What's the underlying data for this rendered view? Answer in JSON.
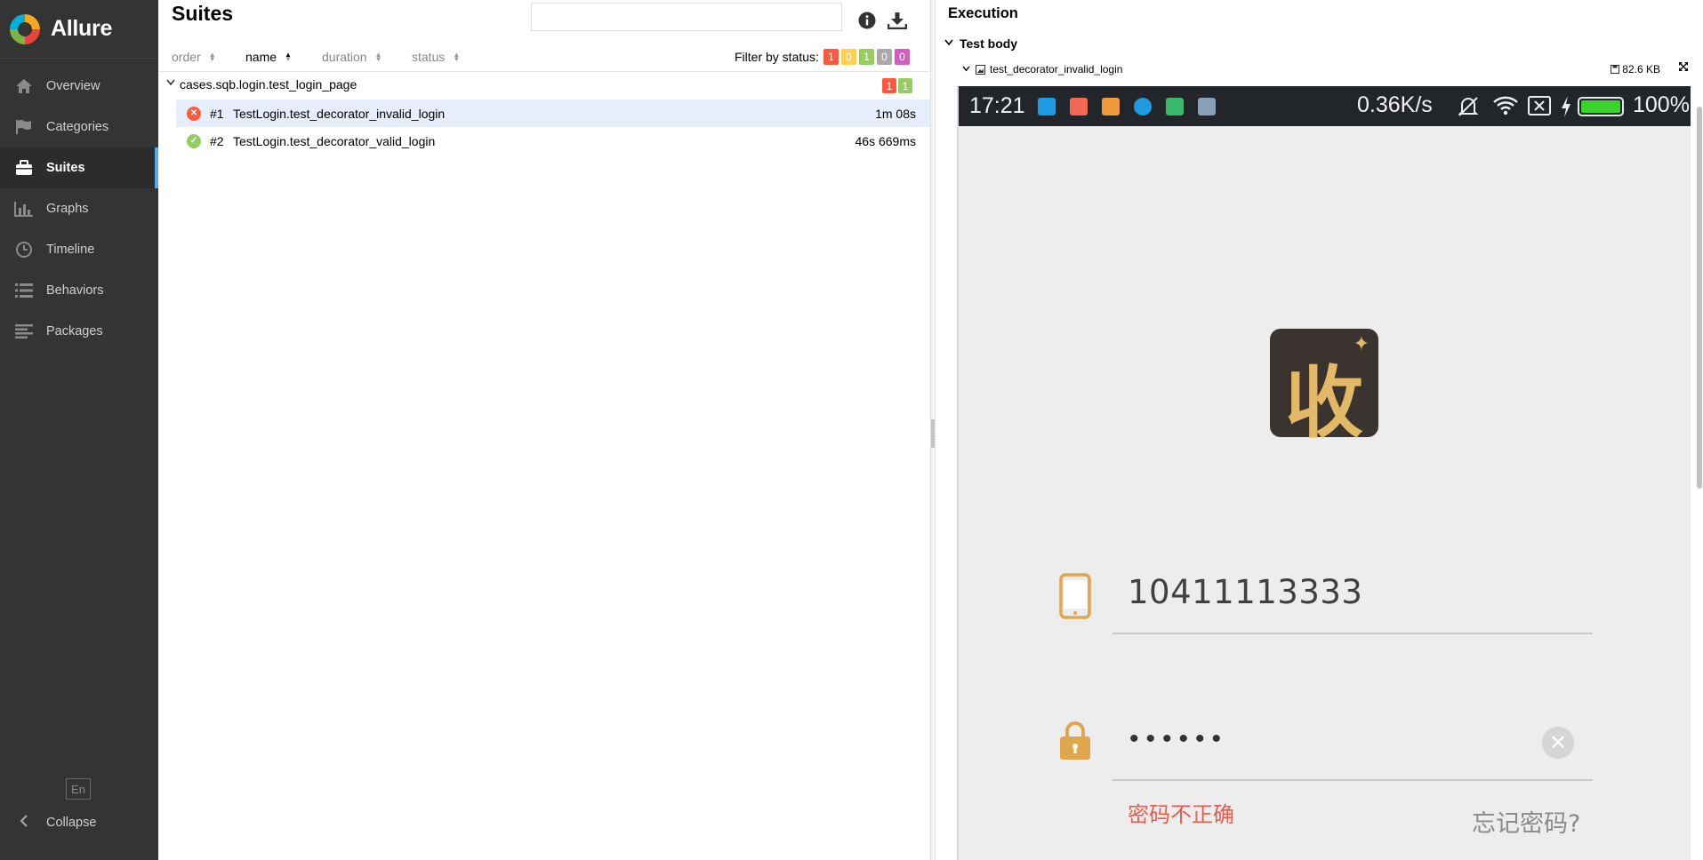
{
  "sidebar": {
    "brand": "Allure",
    "items": [
      {
        "label": "Overview",
        "icon": "home-icon"
      },
      {
        "label": "Categories",
        "icon": "flag-icon"
      },
      {
        "label": "Suites",
        "icon": "briefcase-icon",
        "active": true
      },
      {
        "label": "Graphs",
        "icon": "bar-chart-icon"
      },
      {
        "label": "Timeline",
        "icon": "clock-icon"
      },
      {
        "label": "Behaviors",
        "icon": "list-icon"
      },
      {
        "label": "Packages",
        "icon": "align-left-icon"
      }
    ],
    "language": "En",
    "collapse_label": "Collapse"
  },
  "suites": {
    "title": "Suites",
    "search": {
      "value": "",
      "placeholder": ""
    },
    "sort": {
      "order": "order",
      "name": "name",
      "duration": "duration",
      "status": "status"
    },
    "filter_label": "Filter by status:",
    "filter_counts": [
      {
        "value": "1",
        "status": "failed",
        "color": "#fd5a3e"
      },
      {
        "value": "0",
        "status": "broken",
        "color": "#ffd050"
      },
      {
        "value": "1",
        "status": "passed",
        "color": "#97cc64"
      },
      {
        "value": "0",
        "status": "skipped",
        "color": "#aaaaaa"
      },
      {
        "value": "0",
        "status": "unknown",
        "color": "#d35ebe"
      }
    ],
    "group": {
      "name": "cases.sqb.login.test_login_page",
      "counts": [
        {
          "value": "1",
          "color": "#fd5a3e"
        },
        {
          "value": "1",
          "color": "#97cc64"
        }
      ]
    },
    "tests": [
      {
        "num": "#1",
        "name": "TestLogin.test_decorator_invalid_login",
        "duration": "1m 08s",
        "status": "failed",
        "selected": true
      },
      {
        "num": "#2",
        "name": "TestLogin.test_decorator_valid_login",
        "duration": "46s 669ms",
        "status": "passed",
        "selected": false
      }
    ]
  },
  "execution": {
    "title": "Execution",
    "step": "Test body",
    "attachment": {
      "name": "test_decorator_invalid_login",
      "size": "82.6 KB"
    },
    "phone": {
      "time": "17:21",
      "speed": "0.36K/s",
      "battery": "100%",
      "logo_char": "收",
      "phone_number": "10411113333",
      "password_mask": "••••••",
      "error_text": "密码不正确",
      "forgot_link": "忘记密码?"
    }
  }
}
